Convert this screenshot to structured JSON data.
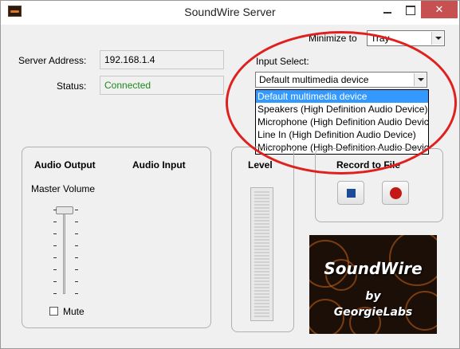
{
  "window": {
    "title": "SoundWire Server"
  },
  "minimize": {
    "label": "Minimize to",
    "value": "Tray"
  },
  "server": {
    "address_label": "Server Address:",
    "address_value": "192.168.1.4",
    "status_label": "Status:",
    "status_value": "Connected",
    "status_color": "#1a8a1a"
  },
  "input_select": {
    "label": "Input Select:",
    "value": "Default multimedia device",
    "options": [
      "Default multimedia device",
      "Speakers (High Definition Audio Device)",
      "Microphone (High Definition Audio Device)",
      "Line In (High Definition Audio Device)",
      "Microphone (High Definition Audio Device)"
    ]
  },
  "audio": {
    "output_label": "Audio Output",
    "input_label": "Audio Input",
    "master_volume_label": "Master Volume",
    "mute_label": "Mute",
    "mute_checked": false
  },
  "level": {
    "label": "Level"
  },
  "record": {
    "label": "Record to File"
  },
  "logo": {
    "line1": "SoundWire",
    "line2": "by",
    "line3": "GeorgieLabs"
  },
  "colors": {
    "accent_highlight": "#3399ff",
    "annotation_red": "#e0201e",
    "record_red": "#c41818",
    "stop_blue": "#1a4a9a"
  }
}
